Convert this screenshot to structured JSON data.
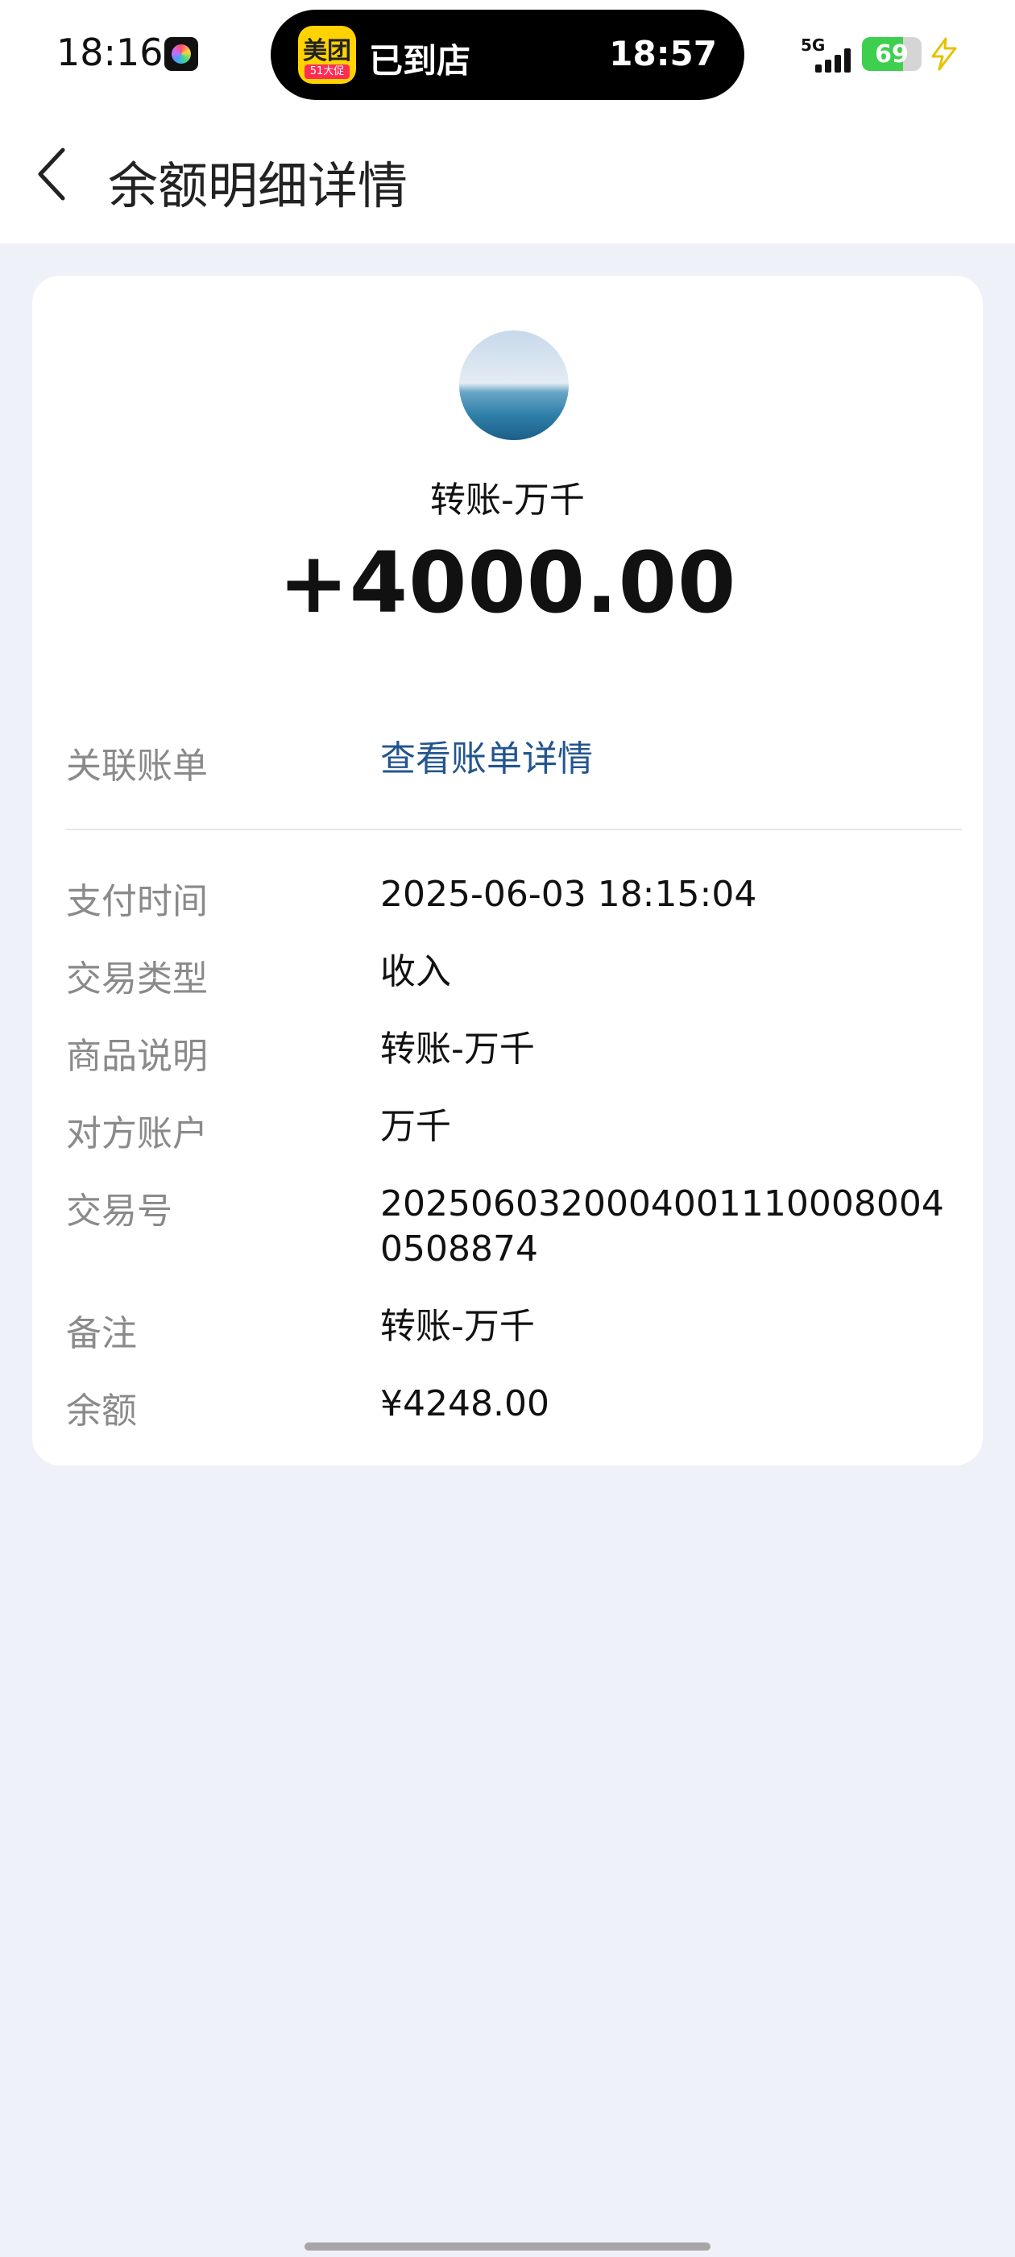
{
  "status_bar": {
    "time": "18:16",
    "island_app_name": "美团",
    "island_app_badge": "51大促",
    "island_status": "已到店",
    "island_time": "18:57",
    "network": "5G",
    "battery": "69"
  },
  "header": {
    "title": "余额明细详情"
  },
  "summary": {
    "counterparty": "转账-万千",
    "amount": "+4000.00"
  },
  "details": {
    "linked_bill": {
      "label": "关联账单",
      "value": "查看账单详情"
    },
    "rows": [
      {
        "label": "支付时间",
        "value": "2025-06-03 18:15:04"
      },
      {
        "label": "交易类型",
        "value": "收入"
      },
      {
        "label": "商品说明",
        "value": "转账-万千"
      },
      {
        "label": "对方账户",
        "value": "万千"
      },
      {
        "label": "交易号",
        "value": "2025060320004001110008004 0508874"
      },
      {
        "label": "备注",
        "value": "转账-万千"
      },
      {
        "label": "余额",
        "value": "¥4248.00"
      }
    ]
  },
  "colors": {
    "background": "#eef1f7",
    "card": "#ffffff",
    "link": "#23558f",
    "label": "#8a8a8a",
    "battery": "#3ecf4f"
  }
}
